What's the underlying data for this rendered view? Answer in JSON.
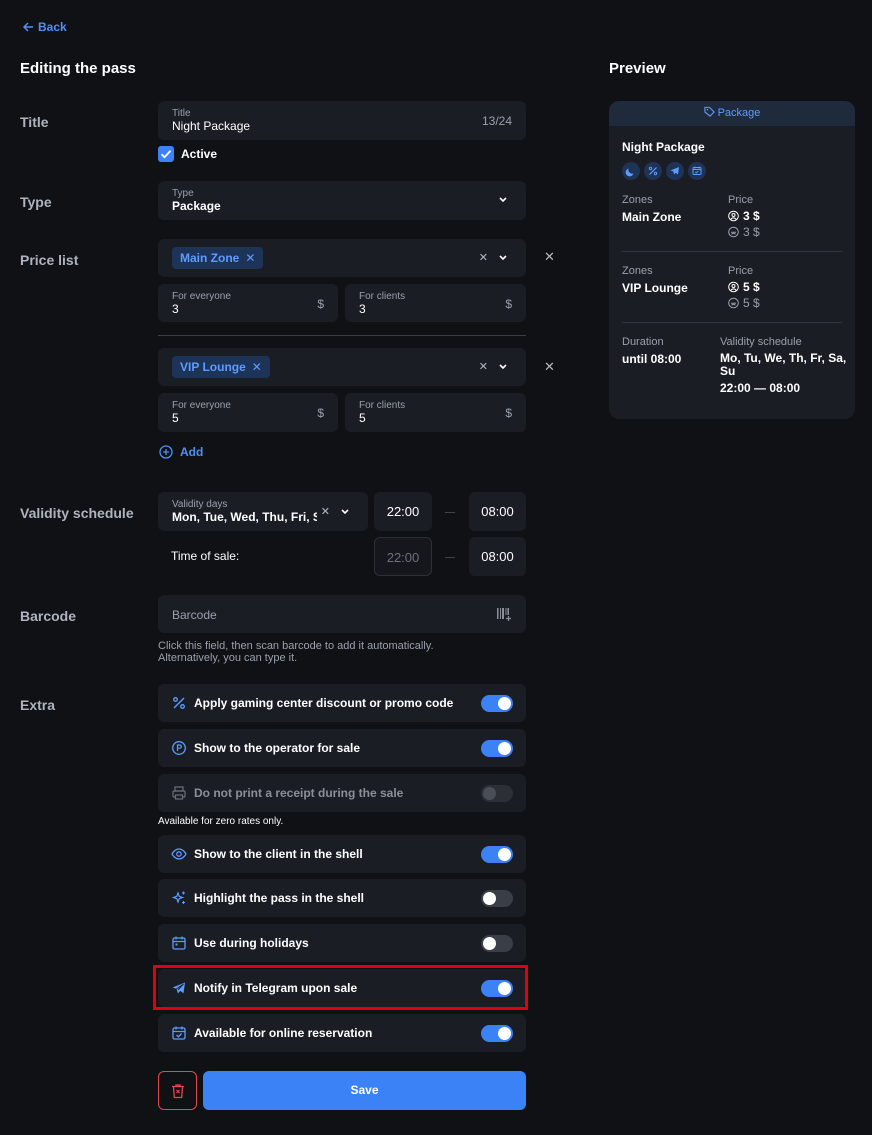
{
  "nav": {
    "back_label": "Back"
  },
  "page_title": "Editing the pass",
  "preview_title": "Preview",
  "labels": {
    "title": "Title",
    "type": "Type",
    "price_list": "Price list",
    "validity_schedule": "Validity schedule",
    "barcode": "Barcode",
    "extra": "Extra"
  },
  "title_field": {
    "label": "Title",
    "value": "Night Package",
    "counter": "13/24"
  },
  "active": {
    "label": "Active",
    "checked": true
  },
  "type_field": {
    "label": "Type",
    "value": "Package"
  },
  "price_lists": [
    {
      "zone": "Main Zone",
      "everyone_label": "For everyone",
      "everyone_value": "3",
      "clients_label": "For clients",
      "clients_value": "3",
      "currency": "$"
    },
    {
      "zone": "VIP Lounge",
      "everyone_label": "For everyone",
      "everyone_value": "5",
      "clients_label": "For clients",
      "clients_value": "5",
      "currency": "$"
    }
  ],
  "add_label": "Add",
  "validity": {
    "days_label": "Validity days",
    "days_value": "Mon, Tue, Wed, Thu, Fri, Sa",
    "from": "22:00",
    "to": "08:00",
    "sale_label": "Time of sale:",
    "sale_from": "22:00",
    "sale_to": "08:00"
  },
  "barcode": {
    "placeholder": "Barcode",
    "hint_line1": "Click this field, then scan barcode to add it automatically.",
    "hint_line2": "Alternatively, you can type it."
  },
  "extras": [
    {
      "label": "Apply gaming center discount or promo code",
      "icon": "percent-icon",
      "on": true,
      "disabled": false
    },
    {
      "label": "Show to the operator for sale",
      "icon": "coin-icon",
      "on": true,
      "disabled": false
    },
    {
      "label": "Do not print a receipt during the sale",
      "icon": "printer-icon",
      "on": false,
      "disabled": true
    },
    {
      "label": "Show to the client in the shell",
      "icon": "eye-icon",
      "on": true,
      "disabled": false
    },
    {
      "label": "Highlight the pass in the shell",
      "icon": "sparkles-icon",
      "on": false,
      "disabled": false
    },
    {
      "label": "Use during holidays",
      "icon": "calendar-icon",
      "on": false,
      "disabled": false
    },
    {
      "label": "Notify in Telegram upon sale",
      "icon": "telegram-icon",
      "on": true,
      "disabled": false
    },
    {
      "label": "Available for online reservation",
      "icon": "calendar-check-icon",
      "on": true,
      "disabled": false
    }
  ],
  "zero_rates_note": "Available for zero rates only.",
  "save_label": "Save",
  "preview": {
    "badge": "Package",
    "name": "Night Package",
    "zones": [
      {
        "zones_label": "Zones",
        "zone": "Main Zone",
        "price_label": "Price",
        "price_main": "3 $",
        "price_sub": "3 $"
      },
      {
        "zones_label": "Zones",
        "zone": "VIP Lounge",
        "price_label": "Price",
        "price_main": "5 $",
        "price_sub": "5 $"
      }
    ],
    "duration_label": "Duration",
    "duration_value": "until 08:00",
    "schedule_label": "Validity schedule",
    "schedule_days_line1": "Mo, Tu, We, Th, Fr, Sa,",
    "schedule_days_line2": "Su",
    "schedule_time": "22:00 — 08:00"
  },
  "colors": {
    "accent": "#3b82f6",
    "highlight": "#e0000f",
    "danger": "#e5484d"
  }
}
